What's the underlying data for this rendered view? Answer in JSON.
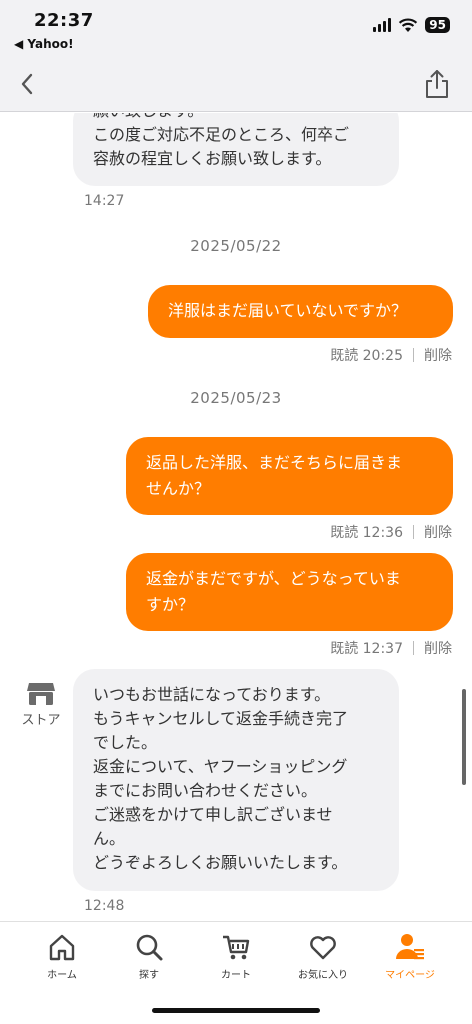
{
  "status_bar": {
    "time": "22:37",
    "back_app": "◀ Yahoo!",
    "battery": "95"
  },
  "messages": {
    "first_in_lines": [
      "願い致します。",
      "この度ご対応不足のところ、何卒ご",
      "容赦の程宜しくお願い致します。"
    ],
    "first_in_time": "14:27",
    "date_1": "2025/05/22",
    "out_1_lines": [
      "洋服はまだ届いていないですか？"
    ],
    "out_1_read": "既読 20:25",
    "out_1_delete": "削除",
    "date_2": "2025/05/23",
    "out_2_lines": [
      "返品した洋服、まだそちらに届きま",
      "せんか？"
    ],
    "out_2_read": "既読 12:36",
    "out_2_delete": "削除",
    "out_3_lines": [
      "返金がまだですが、どうなっていま",
      "すか？"
    ],
    "out_3_read": "既読 12:37",
    "out_3_delete": "削除",
    "store_label": "ストア",
    "last_in_lines": [
      "いつもお世話になっております。",
      "もうキャンセルして返金手続き完了",
      "でした。",
      "返金について、ヤフーショッピング",
      "までにお問い合わせください。",
      "ご迷惑をかけて申し訳ございませ",
      "ん。",
      "どうぞよろしくお願いいたします。"
    ],
    "last_in_time": "12:48"
  },
  "tabbar": {
    "items": [
      {
        "label": "ホーム",
        "icon": "home-icon"
      },
      {
        "label": "探す",
        "icon": "search-icon"
      },
      {
        "label": "カート",
        "icon": "cart-icon"
      },
      {
        "label": "お気に入り",
        "icon": "heart-icon"
      },
      {
        "label": "マイページ",
        "icon": "user-icon"
      }
    ],
    "active_index": 4
  },
  "colors": {
    "accent": "#ff7d00",
    "bubble_in": "#f1f1f3",
    "bar_bg": "#f2f2f4"
  }
}
